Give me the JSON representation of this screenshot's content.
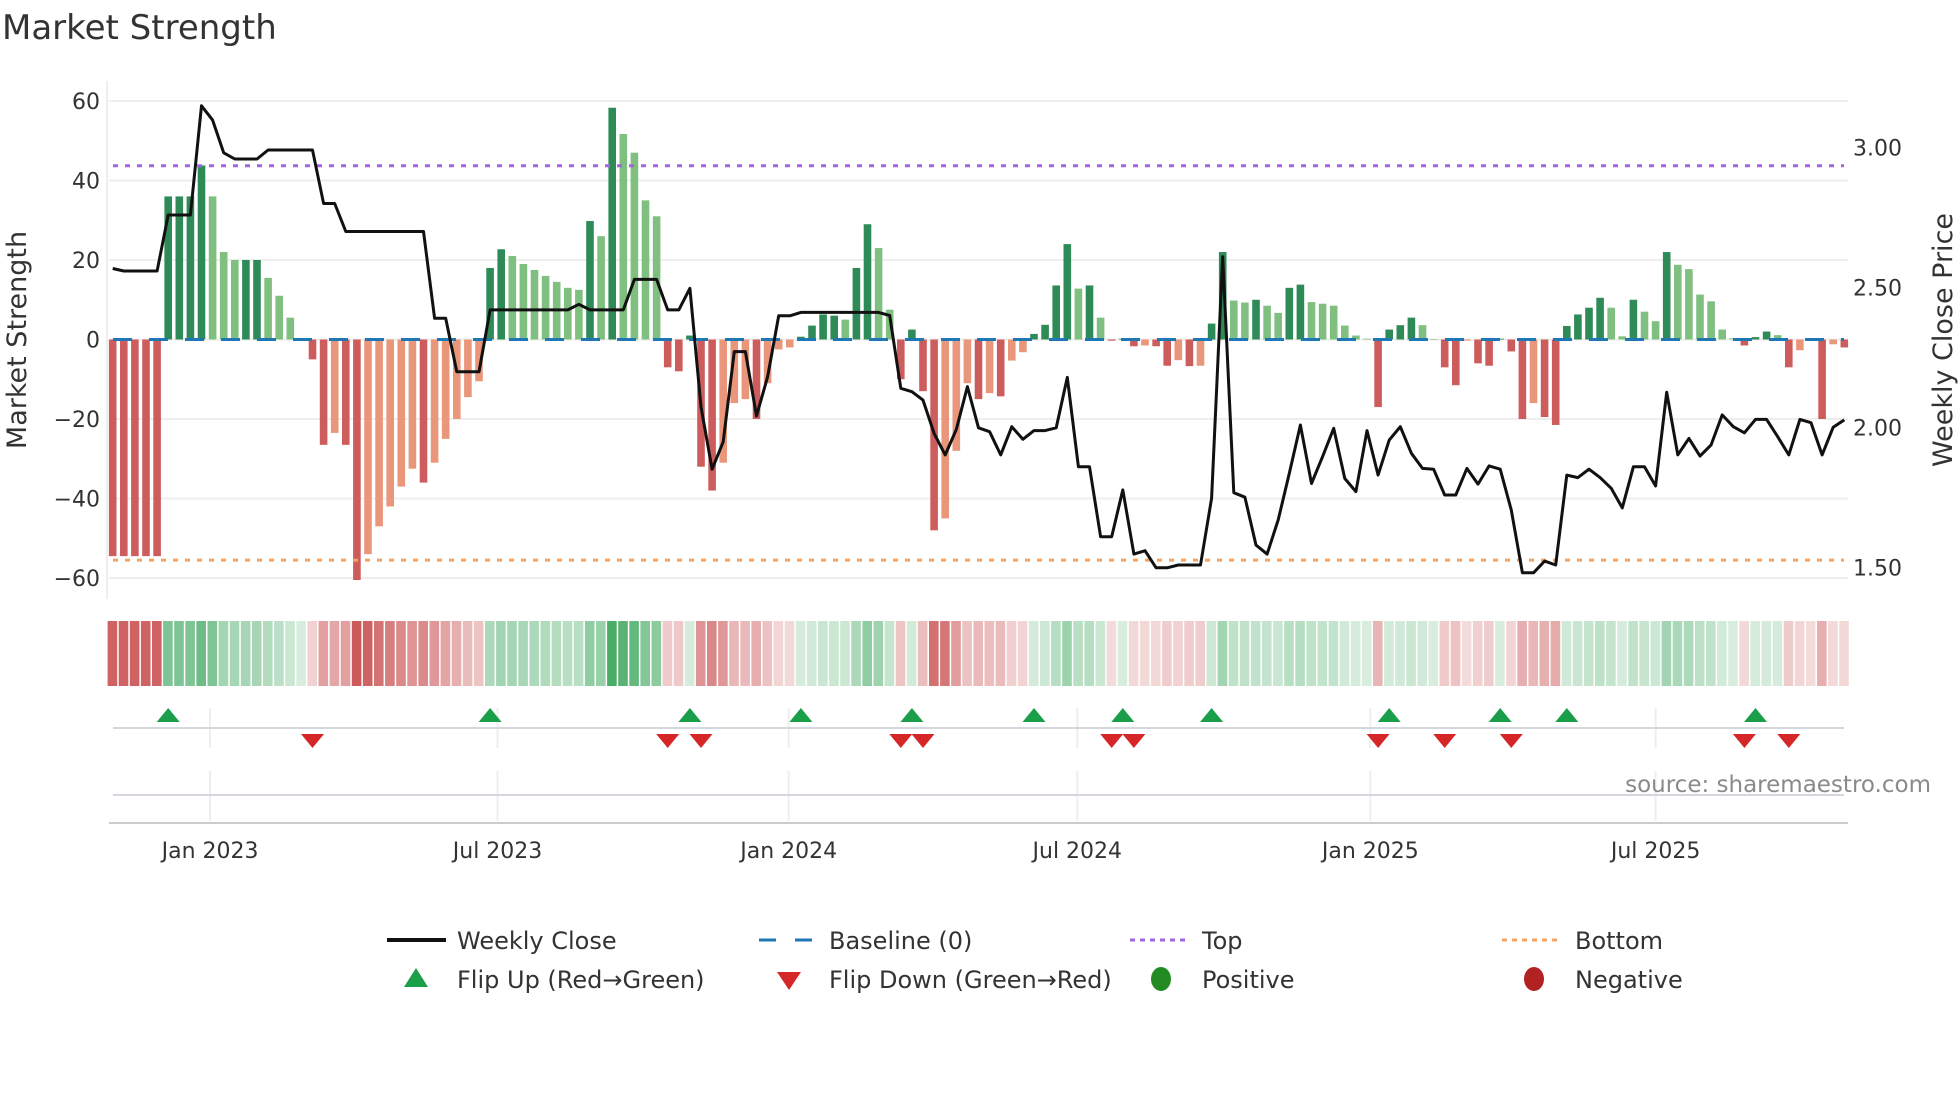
{
  "chart_data": {
    "type": "bar",
    "title": "Market Strength",
    "left_axis": {
      "label": "Market Strength",
      "ticks": [
        "60",
        "40",
        "20",
        "0",
        "−20",
        "−40",
        "−60"
      ],
      "tick_values": [
        60,
        40,
        20,
        0,
        -20,
        -40,
        -60
      ],
      "ylim": [
        -65,
        65
      ]
    },
    "right_axis": {
      "label": "Weekly Close Price",
      "ticks": [
        "3.00",
        "2.50",
        "2.00",
        "1.50"
      ],
      "tick_values": [
        3.0,
        2.5,
        2.0,
        1.5
      ]
    },
    "x_axis": {
      "ticks": [
        "Jan 2023",
        "Jul 2023",
        "Jan 2024",
        "Jul 2024",
        "Jan 2025",
        "Jul 2025"
      ],
      "tick_week_index": [
        8.77,
        34.67,
        60.9,
        86.9,
        113.3,
        139.0
      ],
      "unit": "week index"
    },
    "top_level": 43.7,
    "bottom_level": -55.5,
    "baseline": 0,
    "strength": [
      -54.5,
      -54.5,
      -54.5,
      -54.5,
      -54.5,
      36,
      36,
      36,
      43.8,
      36,
      22,
      20,
      20,
      20,
      15.5,
      11,
      5.5,
      0.3,
      -5,
      -26.5,
      -23.5,
      -26.5,
      -60.5,
      -54,
      -47,
      -42,
      -37,
      -32.5,
      -36,
      -31,
      -25,
      -20,
      -14.5,
      -10.5,
      18,
      22.7,
      21,
      19,
      17.5,
      16,
      14.5,
      13,
      12.5,
      29.8,
      26,
      58.3,
      51.7,
      47,
      35,
      31,
      -7,
      -8,
      1,
      -32,
      -38,
      -31,
      -16,
      -15,
      -20,
      -11,
      -2.5,
      -2,
      0.7,
      3.5,
      6.3,
      6,
      5,
      18,
      29,
      23,
      7.5,
      -10,
      2.5,
      -13,
      -48,
      -45,
      -28,
      -11,
      -15,
      -13.5,
      -14.3,
      -5.3,
      -3.2,
      1.4,
      3.7,
      13.6,
      24,
      12.8,
      13.6,
      5.5,
      -0.3,
      0.2,
      -1.7,
      -1.5,
      -1.7,
      -6.6,
      -5.2,
      -6.7,
      -6.6,
      4,
      22,
      9.8,
      9.3,
      10,
      8.5,
      6.7,
      13,
      13.8,
      9.4,
      9,
      8.5,
      3.5,
      1,
      0.2,
      -17,
      2.5,
      3.6,
      5.5,
      3.6,
      0.1,
      -7,
      -11.5,
      -0.3,
      -6,
      -6.6,
      0.2,
      -3,
      -20,
      -16,
      -19.5,
      -21.5,
      3.4,
      6.3,
      8,
      10.5,
      8,
      0.8,
      10,
      7,
      4.6,
      22,
      18.8,
      17.7,
      11.3,
      9.6,
      2.5,
      0.3,
      -1.5,
      0.6,
      2,
      1.1,
      -7,
      -2.7,
      -0.2,
      -20,
      -1.2,
      -2
    ],
    "bar_shade": "DDDDD DDDD LLL DD LLLL DD L DD LLLLL D LLLLL DD LLLLLLL D L D LLLL DD D DD LLL D LLL DDDD L DD LL D D DD LLL D L D LL DDDD L D L D D D L DD L D L DD LL D LL DD LLLLLL D DDD LL DD L DD D DD L DD DDDD LL D LL D LLLLLL D DD L D LL D L D",
    "weekly_close": [
      2.568,
      2.559,
      2.559,
      2.559,
      2.559,
      2.759,
      2.759,
      2.759,
      3.149,
      3.098,
      2.981,
      2.959,
      2.959,
      2.959,
      2.991,
      2.991,
      2.991,
      2.991,
      2.991,
      2.8,
      2.8,
      2.7,
      2.7,
      2.7,
      2.7,
      2.7,
      2.7,
      2.7,
      2.7,
      2.39,
      2.39,
      2.199,
      2.199,
      2.199,
      2.42,
      2.42,
      2.42,
      2.42,
      2.42,
      2.42,
      2.42,
      2.42,
      2.44,
      2.42,
      2.42,
      2.42,
      2.42,
      2.529,
      2.529,
      2.529,
      2.42,
      2.42,
      2.497,
      2.074,
      1.851,
      1.949,
      2.271,
      2.271,
      2.041,
      2.181,
      2.399,
      2.399,
      2.411,
      2.411,
      2.411,
      2.411,
      2.411,
      2.411,
      2.411,
      2.411,
      2.4,
      2.14,
      2.128,
      2.098,
      1.979,
      1.902,
      1.993,
      2.146,
      1.999,
      1.985,
      1.902,
      2.003,
      1.958,
      1.989,
      1.989,
      1.999,
      2.179,
      1.86,
      1.86,
      1.61,
      1.61,
      1.777,
      1.548,
      1.56,
      1.499,
      1.499,
      1.509,
      1.509,
      1.509,
      1.747,
      2.61,
      1.767,
      1.751,
      1.58,
      1.548,
      1.67,
      1.836,
      2.009,
      1.8,
      1.896,
      1.997,
      1.818,
      1.771,
      1.989,
      1.83,
      1.955,
      2.003,
      1.908,
      1.854,
      1.851,
      1.759,
      1.759,
      1.854,
      1.798,
      1.863,
      1.851,
      1.705,
      1.481,
      1.481,
      1.523,
      1.509,
      1.83,
      1.821,
      1.851,
      1.821,
      1.783,
      1.713,
      1.86,
      1.86,
      1.791,
      2.126,
      1.902,
      1.961,
      1.898,
      1.938,
      2.045,
      2.003,
      1.981,
      2.029,
      2.029,
      1.967,
      1.902,
      2.029,
      2.017,
      1.902,
      2.001,
      2.027
    ],
    "flip_up_weeks": [
      5,
      34,
      52,
      62,
      72,
      83,
      91,
      99,
      115,
      125,
      131,
      148
    ],
    "flip_down_weeks": [
      18,
      50,
      53,
      71,
      73,
      90,
      92,
      114,
      120,
      126,
      147,
      151
    ],
    "legend": {
      "placement": "bottom",
      "items": [
        "Weekly Close",
        "Baseline (0)",
        "Top",
        "Bottom",
        "Flip Up (Red→Green)",
        "Flip Down (Green→Red)",
        "Positive",
        "Negative"
      ]
    },
    "source": "source: sharemaestro.com"
  },
  "colors": {
    "pos_dark": "#2e8b57",
    "pos_light": "#7fbf7f",
    "neg_dark": "#cd5c5c",
    "neg_light": "#e9967a",
    "line": "#111111",
    "baseline": "#1f77b4",
    "top": "#a066e0",
    "bottom": "#f4a460",
    "flip_up": "#1a9e4a",
    "flip_down": "#d62728",
    "positive": "#228b22",
    "negative": "#b22222",
    "strip_pos": "#3aa55a",
    "strip_neg": "#c84c4c"
  }
}
